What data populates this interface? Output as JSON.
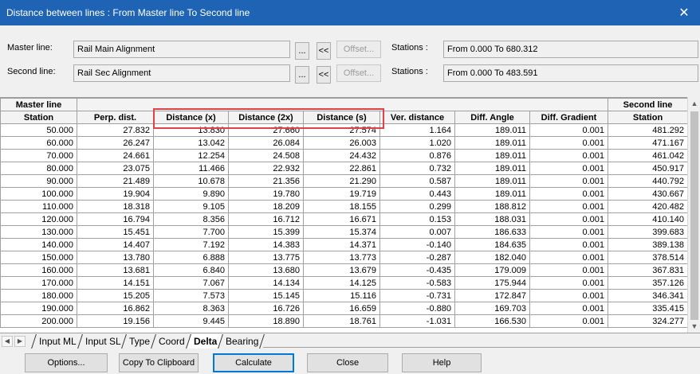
{
  "window": {
    "title": "Distance between lines : From Master line To Second line",
    "close_glyph": "✕"
  },
  "master": {
    "label": "Master line:",
    "value": "Rail Main Alignment",
    "browse": "...",
    "swap": "<<",
    "offset": "Offset...",
    "stations_label": "Stations :",
    "stations_value": "From 0.000 To 680.312"
  },
  "second": {
    "label": "Second line:",
    "value": "Rail Sec Alignment",
    "browse": "...",
    "swap": "<<",
    "offset": "Offset...",
    "stations_label": "Stations :",
    "stations_value": "From 0.000 To 483.591"
  },
  "grid": {
    "group_headers": {
      "master": "Master line",
      "second": "Second line"
    },
    "columns": [
      "Station",
      "Perp. dist.",
      "Distance (x)",
      "Distance (2x)",
      "Distance (s)",
      "Ver. distance",
      "Diff. Angle",
      "Diff. Gradient",
      "Station"
    ],
    "rows": [
      [
        "50.000",
        "27.832",
        "13.830",
        "27.660",
        "27.574",
        "1.164",
        "189.011",
        "0.001",
        "481.292"
      ],
      [
        "60.000",
        "26.247",
        "13.042",
        "26.084",
        "26.003",
        "1.020",
        "189.011",
        "0.001",
        "471.167"
      ],
      [
        "70.000",
        "24.661",
        "12.254",
        "24.508",
        "24.432",
        "0.876",
        "189.011",
        "0.001",
        "461.042"
      ],
      [
        "80.000",
        "23.075",
        "11.466",
        "22.932",
        "22.861",
        "0.732",
        "189.011",
        "0.001",
        "450.917"
      ],
      [
        "90.000",
        "21.489",
        "10.678",
        "21.356",
        "21.290",
        "0.587",
        "189.011",
        "0.001",
        "440.792"
      ],
      [
        "100.000",
        "19.904",
        "9.890",
        "19.780",
        "19.719",
        "0.443",
        "189.011",
        "0.001",
        "430.667"
      ],
      [
        "110.000",
        "18.318",
        "9.105",
        "18.209",
        "18.155",
        "0.299",
        "188.812",
        "0.001",
        "420.482"
      ],
      [
        "120.000",
        "16.794",
        "8.356",
        "16.712",
        "16.671",
        "0.153",
        "188.031",
        "0.001",
        "410.140"
      ],
      [
        "130.000",
        "15.451",
        "7.700",
        "15.399",
        "15.374",
        "0.007",
        "186.633",
        "0.001",
        "399.683"
      ],
      [
        "140.000",
        "14.407",
        "7.192",
        "14.383",
        "14.371",
        "-0.140",
        "184.635",
        "0.001",
        "389.138"
      ],
      [
        "150.000",
        "13.780",
        "6.888",
        "13.775",
        "13.773",
        "-0.287",
        "182.040",
        "0.001",
        "378.514"
      ],
      [
        "160.000",
        "13.681",
        "6.840",
        "13.680",
        "13.679",
        "-0.435",
        "179.009",
        "0.001",
        "367.831"
      ],
      [
        "170.000",
        "14.151",
        "7.067",
        "14.134",
        "14.125",
        "-0.583",
        "175.944",
        "0.001",
        "357.126"
      ],
      [
        "180.000",
        "15.205",
        "7.573",
        "15.145",
        "15.116",
        "-0.731",
        "172.847",
        "0.001",
        "346.341"
      ],
      [
        "190.000",
        "16.862",
        "8.363",
        "16.726",
        "16.659",
        "-0.880",
        "169.703",
        "0.001",
        "335.415"
      ],
      [
        "200.000",
        "19.156",
        "9.445",
        "18.890",
        "18.761",
        "-1.031",
        "166.530",
        "0.001",
        "324.277"
      ]
    ]
  },
  "tabs": [
    {
      "label": "Input ML",
      "active": false
    },
    {
      "label": "Input SL",
      "active": false
    },
    {
      "label": "Type",
      "active": false
    },
    {
      "label": "Coord",
      "active": false
    },
    {
      "label": "Delta",
      "active": true
    },
    {
      "label": "Bearing",
      "active": false
    }
  ],
  "footer": {
    "options": "Options...",
    "copy": "Copy To Clipboard",
    "calculate": "Calculate",
    "close": "Close",
    "help": "Help"
  },
  "colors": {
    "titlebar": "#1f64b4",
    "highlight": "#e0424a",
    "accent": "#0078d7"
  }
}
